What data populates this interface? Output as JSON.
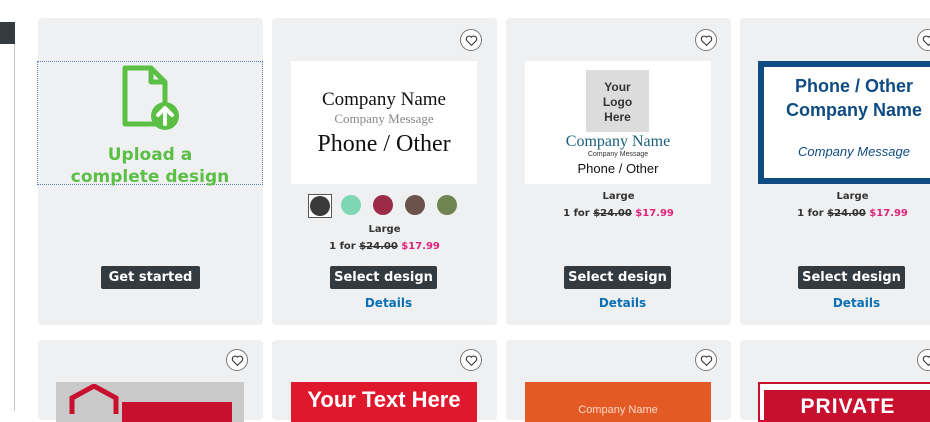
{
  "colors": {
    "accent_green": "#5cbf45",
    "sale_pink": "#e0237b",
    "button_dark": "#333a40",
    "link_blue": "#0a70b3",
    "card_bg": "#eef0f2"
  },
  "upload_card": {
    "title_line1": "Upload a",
    "title_line2": "complete design",
    "icon": "file-upload-icon",
    "button_label": "Get started"
  },
  "products": [
    {
      "preview": {
        "company_name": "Company Name",
        "company_message": "Company Message",
        "phone": "Phone / Other"
      },
      "swatches": [
        "#3a3a3a",
        "#7fd6b5",
        "#9c2b48",
        "#6b524a",
        "#6e8451"
      ],
      "size": "Large",
      "qty_label": "1 for",
      "old_price": "$24.00",
      "sale_price": "$17.99",
      "button_label": "Select design",
      "details_label": "Details"
    },
    {
      "preview": {
        "logo_line1": "Your",
        "logo_line2": "Logo",
        "logo_line3": "Here",
        "company_name": "Company Name",
        "company_message": "Company Message",
        "phone": "Phone / Other"
      },
      "size": "Large",
      "qty_label": "1 for",
      "old_price": "$24.00",
      "sale_price": "$17.99",
      "button_label": "Select design",
      "details_label": "Details"
    },
    {
      "preview": {
        "phone": "Phone / Other",
        "company_name": "Company Name",
        "company_message": "Company Message"
      },
      "size": "Large",
      "qty_label": "1 for",
      "old_price": "$24.00",
      "sale_price": "$17.99",
      "button_label": "Select design",
      "details_label": "Details"
    }
  ],
  "row2": {
    "card2_text": "Your Text Here",
    "card3_text": "Company Name",
    "card4_text": "PRIVATE"
  }
}
